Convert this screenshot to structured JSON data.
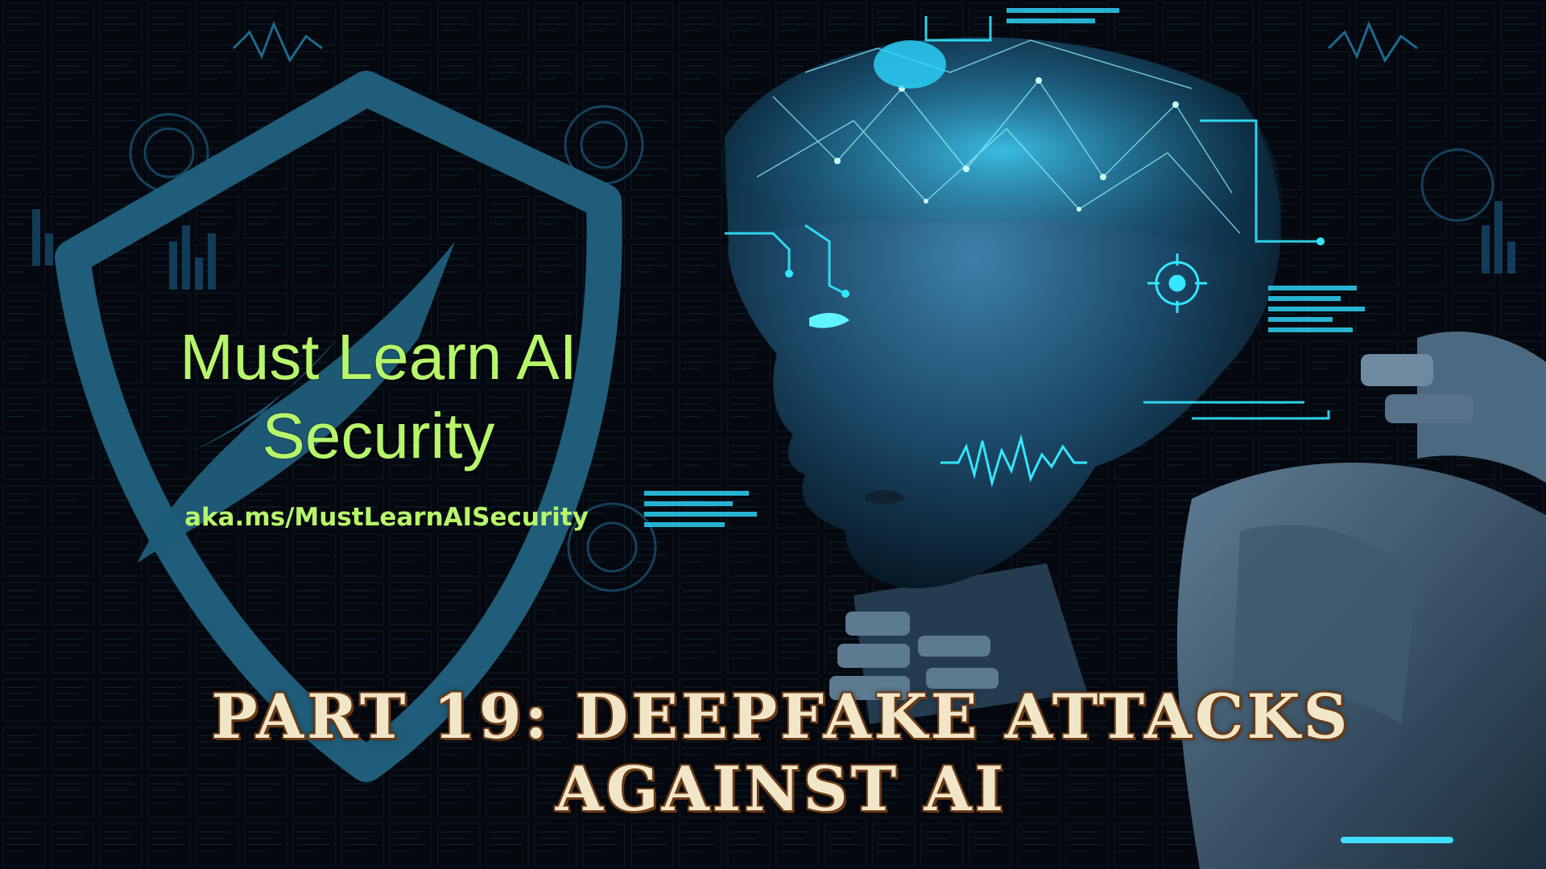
{
  "brand": {
    "title_line1": "Must Learn AI",
    "title_line2": "Security",
    "link": "aka.ms/MustLearnAISecurity"
  },
  "episode": {
    "line1": "PART 19: DEEPFAKE ATTACKS",
    "line2": "AGAINST AI"
  },
  "colors": {
    "brand_green": "#b7f56a",
    "shield_blue": "#1f5d7a",
    "title_cream": "#f2e6c8",
    "title_outline": "#6a3a16",
    "cyan_glow": "#22e0ff"
  },
  "icons": [
    "shield-icon",
    "robot-head-illustration",
    "target-reticle-icon",
    "waveform-icon"
  ]
}
